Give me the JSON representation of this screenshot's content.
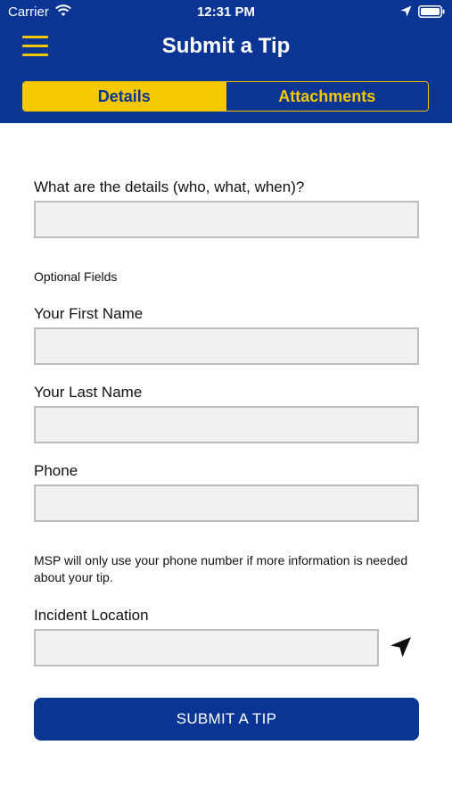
{
  "status_bar": {
    "carrier": "Carrier",
    "time": "12:31 PM",
    "icons": [
      "wifi-icon",
      "location-arrow-icon",
      "battery-icon"
    ]
  },
  "header": {
    "title": "Submit a Tip",
    "menu_icon": "hamburger-menu-icon",
    "tabs": [
      {
        "label": "Details",
        "active": true
      },
      {
        "label": "Attachments",
        "active": false
      }
    ]
  },
  "form": {
    "details_label": "What are the details (who, what, when)?",
    "details_value": "",
    "optional_heading": "Optional Fields",
    "first_name_label": "Your First Name",
    "first_name_value": "",
    "last_name_label": "Your Last Name",
    "last_name_value": "",
    "phone_label": "Phone",
    "phone_value": "",
    "phone_note": "MSP will only use your phone number if more information is needed about your tip.",
    "location_label": "Incident Location",
    "location_value": "",
    "locate_icon": "location-arrow-icon"
  },
  "submit_label": "SUBMIT A TIP",
  "colors": {
    "brand_blue": "#0A3594",
    "brand_yellow": "#F5C800",
    "field_bg": "#F1F1F1",
    "field_border": "#BDBDBD"
  }
}
